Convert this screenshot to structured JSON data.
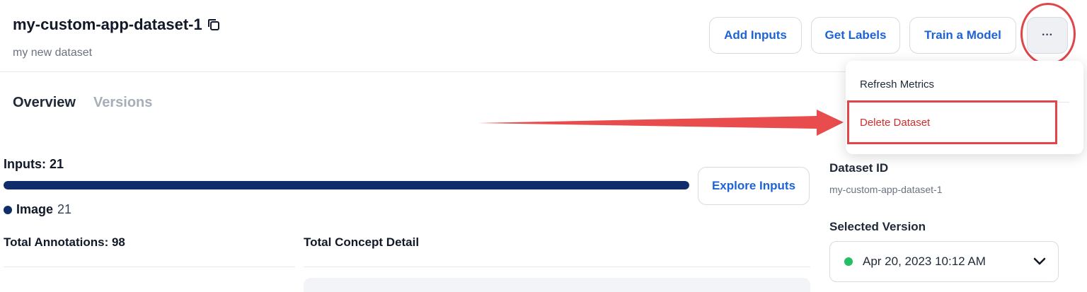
{
  "header": {
    "title": "my-custom-app-dataset-1",
    "subtitle": "my new dataset"
  },
  "actions": {
    "add_inputs": "Add Inputs",
    "get_labels": "Get Labels",
    "train_model": "Train a Model",
    "more": "···"
  },
  "menu": {
    "refresh": "Refresh Metrics",
    "delete": "Delete Dataset"
  },
  "tabs": [
    "Overview",
    "Versions"
  ],
  "inputs": {
    "label": "Inputs: 21",
    "fill_fraction": 1.0,
    "legend": {
      "label": "Image",
      "count": "21"
    },
    "explore_button": "Explore Inputs"
  },
  "totals": {
    "annotations": "Total Annotations: 98",
    "concept_detail": "Total Concept Detail"
  },
  "dataset": {
    "id_label": "Dataset ID",
    "id_value": "my-custom-app-dataset-1",
    "version_label": "Selected Version",
    "version_value": "Apr 20, 2023 10:12 AM"
  },
  "colors": {
    "accent": "#1d63d8",
    "bar": "#0f2d6b",
    "danger": "#d22d2d",
    "annotation": "#e0454a",
    "status": "#22c063"
  }
}
